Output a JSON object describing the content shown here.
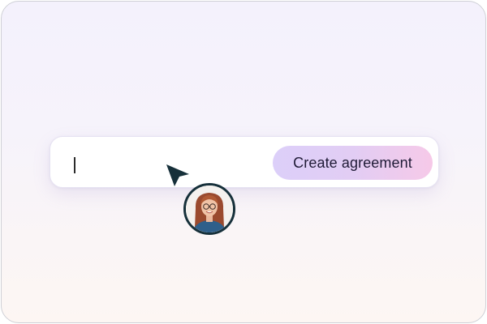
{
  "create_button": {
    "label": "Create agreement"
  },
  "text_field": {
    "value": "",
    "placeholder": ""
  },
  "icons": {
    "cursor": "cursor-arrow-icon",
    "avatar": "user-avatar"
  },
  "colors": {
    "button_gradient_start": "#dccff9",
    "button_gradient_end": "#f6c9e8",
    "cursor": "#16303a",
    "avatar_ring": "#16303a"
  }
}
